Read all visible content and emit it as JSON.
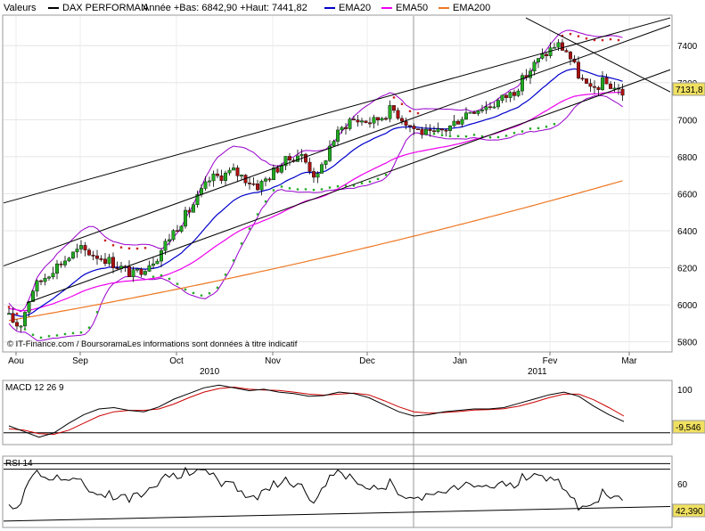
{
  "legend": {
    "series_label": "Valeurs",
    "instrument": "DAX PERFORMAN",
    "range_text": "Année +Bas: 6842,90 +Haut: 7441,82",
    "ema20_label": "EMA20",
    "ema50_label": "EMA50",
    "ema200_label": "EMA200"
  },
  "colors": {
    "up_candle": "#22aa22",
    "down_candle": "#aa1111",
    "ema20": "#0000cc",
    "ema50": "#ee00ee",
    "ema200": "#ee7722",
    "bollinger": "#9900cc",
    "sar_up": "#22aa22",
    "sar_down": "#cc2222",
    "macd": "#000000",
    "signal": "#cc0000",
    "badge": "#f0e060"
  },
  "copyright": "© IT-Finance.com / BoursoramaLes informations sont données à titre indicatif",
  "x_months": [
    "Aou",
    "Sep",
    "Oct",
    "Nov",
    "Dec",
    "Jan",
    "Fev",
    "Mar"
  ],
  "x_years": [
    "2010",
    "2011"
  ],
  "price_panel": {
    "y_ticks": [
      "7400",
      "7200",
      "7000",
      "6800",
      "6600",
      "6400",
      "6200",
      "6000",
      "5800"
    ],
    "last_price_badge": "7131,8"
  },
  "macd_panel": {
    "label": "MACD 12 26 9",
    "y_tick": "100",
    "last_value_badge": "-9,546"
  },
  "rsi_panel": {
    "label": "RSI 14",
    "y_tick": "60",
    "last_value_badge": "42,390"
  },
  "chart_data": [
    {
      "type": "candlestick",
      "title": "DAX PERFORMAN",
      "ylim": [
        5750,
        7560
      ],
      "grid": true,
      "x": [
        "2010-08-02",
        "2010-08-16",
        "2010-09-01",
        "2010-09-15",
        "2010-10-01",
        "2010-10-15",
        "2010-11-01",
        "2010-11-15",
        "2010-12-01",
        "2010-12-15",
        "2011-01-03",
        "2011-01-17",
        "2011-02-01",
        "2011-02-15",
        "2011-02-24"
      ],
      "close": [
        5920,
        6200,
        6280,
        6150,
        6320,
        6520,
        6800,
        6720,
        6970,
        7000,
        6950,
        7080,
        7330,
        7420,
        7131.8
      ],
      "year_low": 6842.9,
      "year_high": 7441.82,
      "last_value": 7131.8
    },
    {
      "type": "line",
      "name": "MACD 12 26 9",
      "last_value": -9.546
    },
    {
      "type": "line",
      "name": "RSI 14",
      "last_value": 42.39
    }
  ]
}
